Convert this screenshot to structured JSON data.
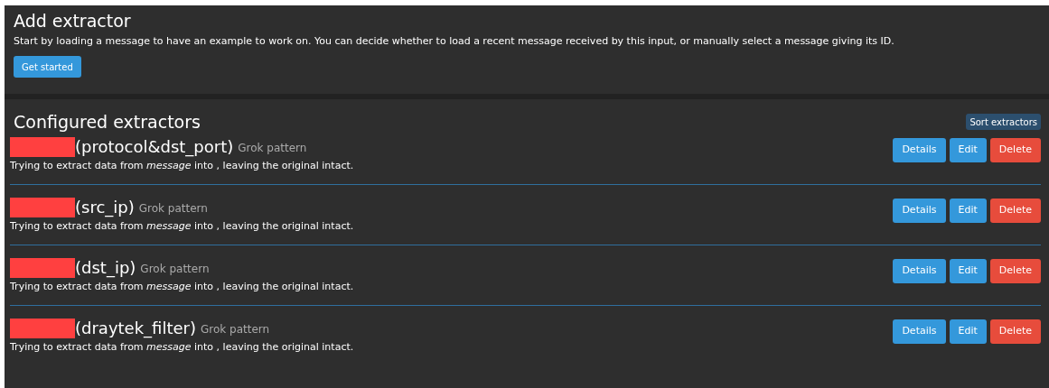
{
  "add_extractor": {
    "title": "Add extractor",
    "description": "Start by loading a message to have an example to work on. You can decide whether to load a recent message received by this input, or manually select a message giving its ID.",
    "button": "Get started"
  },
  "configured": {
    "title": "Configured extractors",
    "sort_button": "Sort extractors",
    "extractors": [
      {
        "name": "(protocol&dst_port)",
        "type": "Grok pattern",
        "description": "Trying to extract data from *message* into , leaving the original intact.",
        "buttons": [
          "Details",
          "Edit",
          "Delete"
        ]
      },
      {
        "name": "(src_ip)",
        "type": "Grok pattern",
        "description": "Trying to extract data from *message* into , leaving the original intact.",
        "buttons": [
          "Details",
          "Edit",
          "Delete"
        ]
      },
      {
        "name": "(dst_ip)",
        "type": "Grok pattern",
        "description": "Trying to extract data from *message* into , leaving the original intact.",
        "buttons": [
          "Details",
          "Edit",
          "Delete"
        ]
      },
      {
        "name": "(draytek_filter)",
        "type": "Grok pattern",
        "description": "Trying to extract data from *message* into , leaving the original intact.",
        "buttons": [
          "Details",
          "Edit",
          "Delete"
        ]
      }
    ]
  }
}
